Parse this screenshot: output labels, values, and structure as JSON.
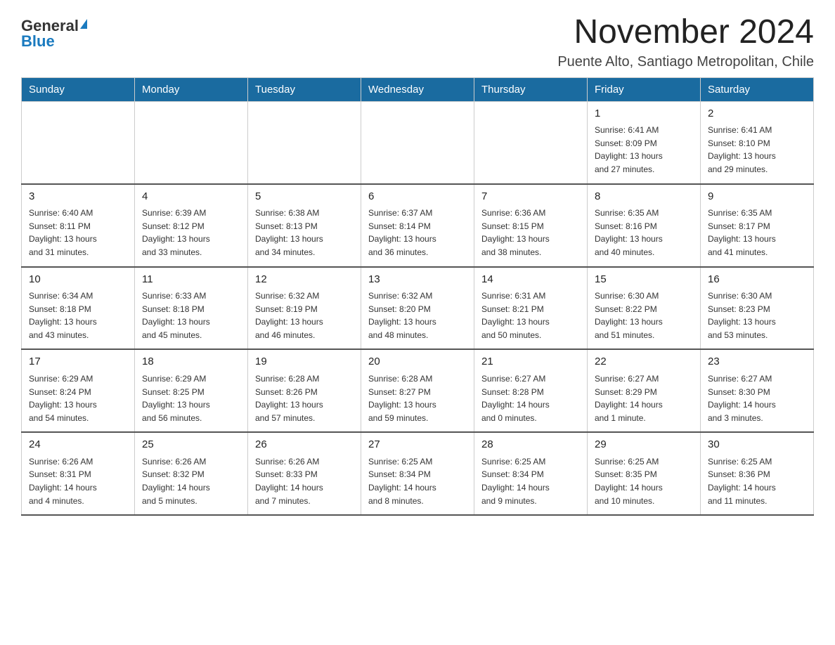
{
  "header": {
    "logo_general": "General",
    "logo_blue": "Blue",
    "month_title": "November 2024",
    "subtitle": "Puente Alto, Santiago Metropolitan, Chile"
  },
  "days_of_week": [
    "Sunday",
    "Monday",
    "Tuesday",
    "Wednesday",
    "Thursday",
    "Friday",
    "Saturday"
  ],
  "weeks": [
    [
      {
        "day": "",
        "info": ""
      },
      {
        "day": "",
        "info": ""
      },
      {
        "day": "",
        "info": ""
      },
      {
        "day": "",
        "info": ""
      },
      {
        "day": "",
        "info": ""
      },
      {
        "day": "1",
        "info": "Sunrise: 6:41 AM\nSunset: 8:09 PM\nDaylight: 13 hours\nand 27 minutes."
      },
      {
        "day": "2",
        "info": "Sunrise: 6:41 AM\nSunset: 8:10 PM\nDaylight: 13 hours\nand 29 minutes."
      }
    ],
    [
      {
        "day": "3",
        "info": "Sunrise: 6:40 AM\nSunset: 8:11 PM\nDaylight: 13 hours\nand 31 minutes."
      },
      {
        "day": "4",
        "info": "Sunrise: 6:39 AM\nSunset: 8:12 PM\nDaylight: 13 hours\nand 33 minutes."
      },
      {
        "day": "5",
        "info": "Sunrise: 6:38 AM\nSunset: 8:13 PM\nDaylight: 13 hours\nand 34 minutes."
      },
      {
        "day": "6",
        "info": "Sunrise: 6:37 AM\nSunset: 8:14 PM\nDaylight: 13 hours\nand 36 minutes."
      },
      {
        "day": "7",
        "info": "Sunrise: 6:36 AM\nSunset: 8:15 PM\nDaylight: 13 hours\nand 38 minutes."
      },
      {
        "day": "8",
        "info": "Sunrise: 6:35 AM\nSunset: 8:16 PM\nDaylight: 13 hours\nand 40 minutes."
      },
      {
        "day": "9",
        "info": "Sunrise: 6:35 AM\nSunset: 8:17 PM\nDaylight: 13 hours\nand 41 minutes."
      }
    ],
    [
      {
        "day": "10",
        "info": "Sunrise: 6:34 AM\nSunset: 8:18 PM\nDaylight: 13 hours\nand 43 minutes."
      },
      {
        "day": "11",
        "info": "Sunrise: 6:33 AM\nSunset: 8:18 PM\nDaylight: 13 hours\nand 45 minutes."
      },
      {
        "day": "12",
        "info": "Sunrise: 6:32 AM\nSunset: 8:19 PM\nDaylight: 13 hours\nand 46 minutes."
      },
      {
        "day": "13",
        "info": "Sunrise: 6:32 AM\nSunset: 8:20 PM\nDaylight: 13 hours\nand 48 minutes."
      },
      {
        "day": "14",
        "info": "Sunrise: 6:31 AM\nSunset: 8:21 PM\nDaylight: 13 hours\nand 50 minutes."
      },
      {
        "day": "15",
        "info": "Sunrise: 6:30 AM\nSunset: 8:22 PM\nDaylight: 13 hours\nand 51 minutes."
      },
      {
        "day": "16",
        "info": "Sunrise: 6:30 AM\nSunset: 8:23 PM\nDaylight: 13 hours\nand 53 minutes."
      }
    ],
    [
      {
        "day": "17",
        "info": "Sunrise: 6:29 AM\nSunset: 8:24 PM\nDaylight: 13 hours\nand 54 minutes."
      },
      {
        "day": "18",
        "info": "Sunrise: 6:29 AM\nSunset: 8:25 PM\nDaylight: 13 hours\nand 56 minutes."
      },
      {
        "day": "19",
        "info": "Sunrise: 6:28 AM\nSunset: 8:26 PM\nDaylight: 13 hours\nand 57 minutes."
      },
      {
        "day": "20",
        "info": "Sunrise: 6:28 AM\nSunset: 8:27 PM\nDaylight: 13 hours\nand 59 minutes."
      },
      {
        "day": "21",
        "info": "Sunrise: 6:27 AM\nSunset: 8:28 PM\nDaylight: 14 hours\nand 0 minutes."
      },
      {
        "day": "22",
        "info": "Sunrise: 6:27 AM\nSunset: 8:29 PM\nDaylight: 14 hours\nand 1 minute."
      },
      {
        "day": "23",
        "info": "Sunrise: 6:27 AM\nSunset: 8:30 PM\nDaylight: 14 hours\nand 3 minutes."
      }
    ],
    [
      {
        "day": "24",
        "info": "Sunrise: 6:26 AM\nSunset: 8:31 PM\nDaylight: 14 hours\nand 4 minutes."
      },
      {
        "day": "25",
        "info": "Sunrise: 6:26 AM\nSunset: 8:32 PM\nDaylight: 14 hours\nand 5 minutes."
      },
      {
        "day": "26",
        "info": "Sunrise: 6:26 AM\nSunset: 8:33 PM\nDaylight: 14 hours\nand 7 minutes."
      },
      {
        "day": "27",
        "info": "Sunrise: 6:25 AM\nSunset: 8:34 PM\nDaylight: 14 hours\nand 8 minutes."
      },
      {
        "day": "28",
        "info": "Sunrise: 6:25 AM\nSunset: 8:34 PM\nDaylight: 14 hours\nand 9 minutes."
      },
      {
        "day": "29",
        "info": "Sunrise: 6:25 AM\nSunset: 8:35 PM\nDaylight: 14 hours\nand 10 minutes."
      },
      {
        "day": "30",
        "info": "Sunrise: 6:25 AM\nSunset: 8:36 PM\nDaylight: 14 hours\nand 11 minutes."
      }
    ]
  ]
}
